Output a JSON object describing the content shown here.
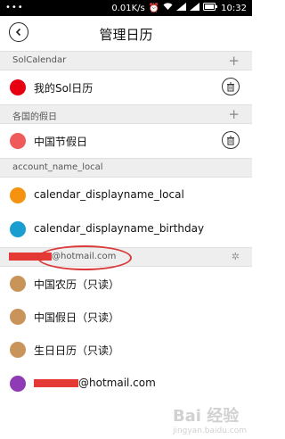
{
  "status_bar": {
    "dots": "•••",
    "speed": "0.01K/s",
    "time": "10:32"
  },
  "header": {
    "title": "管理日历",
    "back_icon": "back-arrow-icon"
  },
  "sections": [
    {
      "label": "SolCalendar",
      "action": "+"
    },
    {
      "label": "各国的假日",
      "action": "+"
    },
    {
      "label": "account_name_local"
    },
    {
      "label_suffix": "@hotmail.com",
      "action_icon": "gear-icon"
    }
  ],
  "calendars": {
    "sol": [
      {
        "name": "我的Sol日历",
        "color": "#e60012"
      }
    ],
    "holidays": [
      {
        "name": "中国节假日",
        "color": "#ef5a5a"
      }
    ],
    "local": [
      {
        "name": "calendar_displayname_local",
        "color": "#f5920f"
      },
      {
        "name": "calendar_displayname_birthday",
        "color": "#1a9ed0"
      }
    ],
    "hotmail": [
      {
        "name": "中国农历（只读）",
        "color": "#c8945a"
      },
      {
        "name": "中国假日（只读）",
        "color": "#c8945a"
      },
      {
        "name": "生日日历（只读）",
        "color": "#c8945a"
      },
      {
        "name_suffix": "@hotmail.com",
        "color": "#8e3bb5"
      }
    ]
  },
  "watermark": {
    "text": "Bai 经验",
    "sub": "jingyan.baidu.com"
  }
}
